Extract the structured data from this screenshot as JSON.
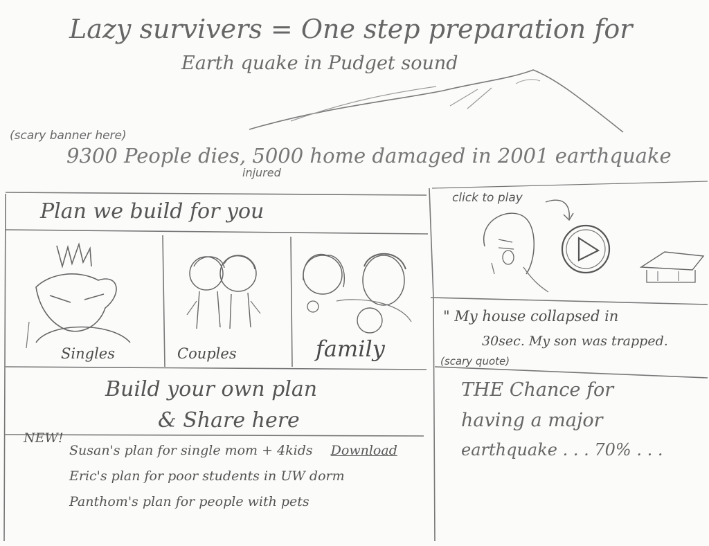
{
  "header": {
    "title": "Lazy survivers = One step preparation for",
    "subtitle": "Earth quake in Pudget sound"
  },
  "banner": {
    "note": "(scary banner here)",
    "stat": "9300 People dies, 5000 home damaged in 2001 earthquake",
    "stat_annotation": "injured"
  },
  "plans": {
    "heading": "Plan we build for you",
    "items": [
      {
        "label": "Singles"
      },
      {
        "label": "Couples"
      },
      {
        "label": "family"
      }
    ]
  },
  "build": {
    "line1": "Build your own plan",
    "line2": "& Share here"
  },
  "shared": {
    "badge": "NEW!",
    "items": [
      {
        "text": "Susan's plan for single mom + 4kids",
        "link": "Download"
      },
      {
        "text": "Eric's plan for poor students in UW dorm"
      },
      {
        "text": "Panthom's plan for people with pets"
      }
    ]
  },
  "video": {
    "hint": "click to play"
  },
  "quote": {
    "line1": "\" My house collapsed in",
    "line2": "30sec. My son was trapped.",
    "note": "(scary quote)"
  },
  "chance": {
    "line1": "THE Chance for",
    "line2": "having a major",
    "line3": "earthquake . . . 70% . . ."
  }
}
